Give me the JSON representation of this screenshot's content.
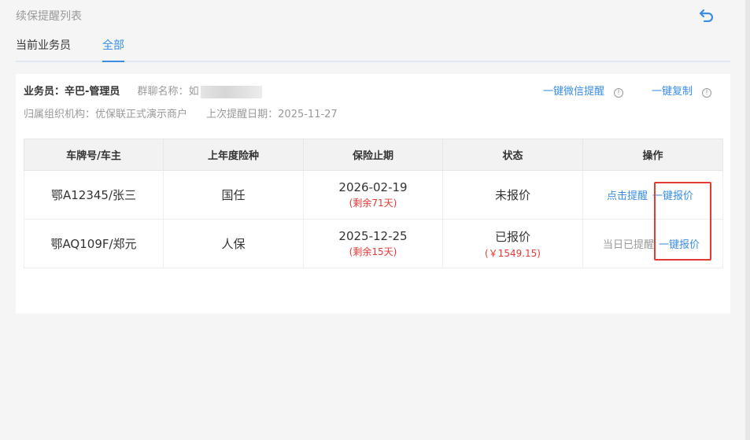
{
  "header": {
    "title": "续保提醒列表",
    "back_icon": "undo-arrow-icon"
  },
  "tabs": [
    {
      "label": "当前业务员",
      "active": false
    },
    {
      "label": "全部",
      "active": true
    }
  ],
  "info": {
    "agent": "业务员：辛巴-管理员",
    "group_label": "群聊名称：",
    "group_value_visible": "如",
    "org": "归属组织机构：优保联正式演示商户",
    "last_reminder": "上次提醒日期：2025-11-27",
    "wechat_reminder": "一键微信提醒",
    "copy": "一键复制"
  },
  "table": {
    "headers": [
      "车牌号/车主",
      "上年度险种",
      "保险止期",
      "状态",
      "操作"
    ],
    "rows": [
      {
        "plate": "鄂A12345/张三",
        "insurer": "国任",
        "end_date": "2026-02-19",
        "remaining": "(剩余71天)",
        "status": "未报价",
        "status_sub": "",
        "op_left": "点击提醒",
        "op_left_active": true,
        "op_right": "一键报价"
      },
      {
        "plate": "鄂AQ109F/郑元",
        "insurer": "人保",
        "end_date": "2025-12-25",
        "remaining": "(剩余15天)",
        "status": "已报价",
        "status_sub": "(￥1549.15)",
        "op_left": "当日已提醒",
        "op_left_active": false,
        "op_right": "一键报价"
      }
    ]
  },
  "colors": {
    "accent": "#3a8ee6",
    "warning": "#e53935",
    "muted": "#999999"
  }
}
